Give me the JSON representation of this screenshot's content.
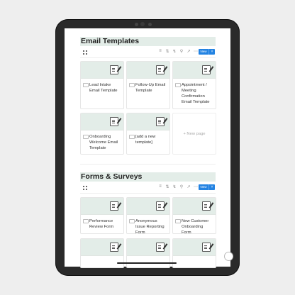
{
  "sections": [
    {
      "title": "Email Templates",
      "new_label": "New",
      "cards": [
        {
          "label": "Lead Intake Email Template"
        },
        {
          "label": "Follow-Up Email Template"
        },
        {
          "label": "Appointment / Meeting Confirmation Email Template"
        },
        {
          "label": "Onboarding Welcome Email Template"
        },
        {
          "label": "[add a new template]"
        }
      ],
      "new_page_label": "+ New page"
    },
    {
      "title": "Forms & Surveys",
      "new_label": "New",
      "cards": [
        {
          "label": "Performance Review Form"
        },
        {
          "label": "Anonymous Issue Reporting Form"
        },
        {
          "label": "New Customer Onboarding Form"
        },
        {
          "label": ""
        },
        {
          "label": ""
        },
        {
          "label": ""
        }
      ]
    }
  ],
  "icons": {
    "toolbar": [
      "filter-icon",
      "sort-icon",
      "lightning-icon",
      "search-icon",
      "expand-icon",
      "more-icon"
    ],
    "view": "gallery-grid-icon",
    "cover": "edit-document-icon",
    "card": "page-icon"
  },
  "colors": {
    "accent": "#2383e2",
    "cover": "#e3ede8",
    "device": "#2a2a2a"
  }
}
